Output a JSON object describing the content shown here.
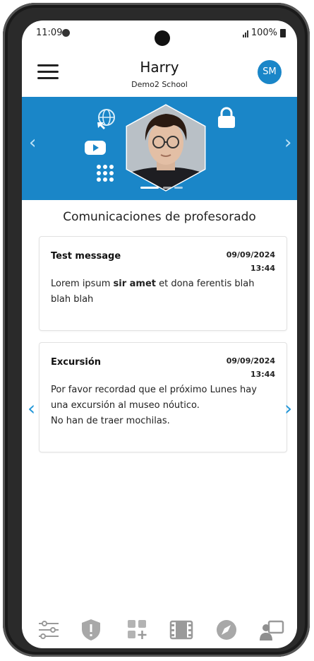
{
  "status": {
    "time": "11:09",
    "battery": "100%"
  },
  "header": {
    "title": "Harry",
    "subtitle": "Demo2 School",
    "avatar_initials": "SM"
  },
  "banner": {
    "bg_color": "#1a86c8",
    "icons": [
      "globe-cursor-icon",
      "youtube-icon",
      "apps-grid-icon",
      "lock-icon"
    ]
  },
  "section": {
    "title": "Comunicaciones de profesorado"
  },
  "messages": [
    {
      "title": "Test message",
      "date": "09/09/2024",
      "time": "13:44",
      "body_before": "Lorem ipsum ",
      "body_bold": "sir amet",
      "body_after": " et dona ferentis blah blah blah"
    },
    {
      "title": "Excursión",
      "date": "09/09/2024",
      "time": "13:44",
      "line1": "Por favor recordad que el próximo Lunes hay",
      "line2": "una excursión al museo nóutico.",
      "line3": "No han de traer mochilas."
    }
  ],
  "nav": {
    "prev": "‹",
    "next": "›",
    "items": [
      "sliders-icon",
      "shield-alert-icon",
      "add-grid-icon",
      "film-icon",
      "compass-icon",
      "presenter-icon"
    ]
  },
  "accent": "#2196d8"
}
